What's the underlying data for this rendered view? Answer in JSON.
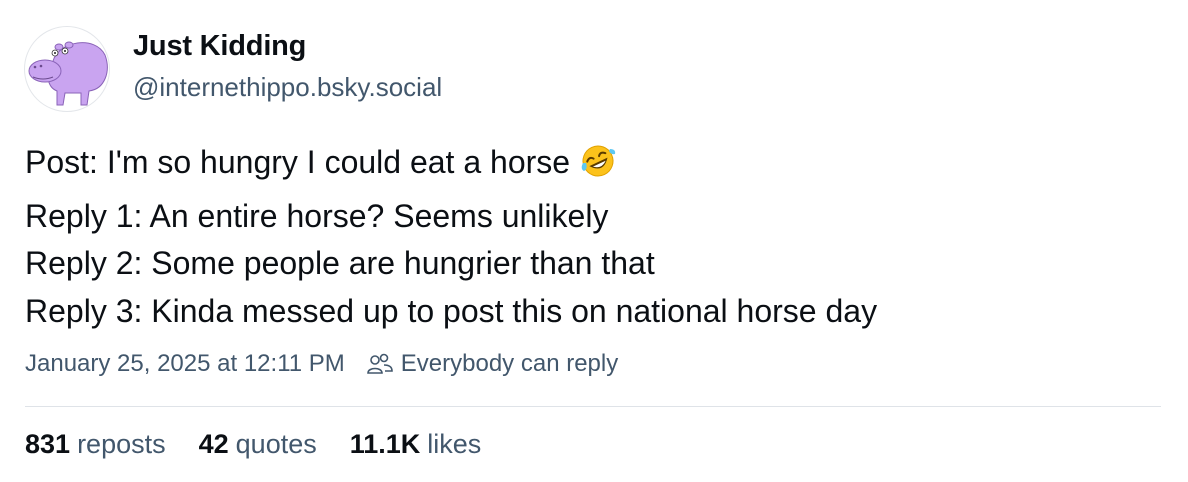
{
  "author": {
    "display_name": "Just Kidding",
    "handle": "@internethippo.bsky.social",
    "avatar_icon": "hippo-avatar-icon"
  },
  "post": {
    "lines": [
      "Post: I'm so hungry I could eat a horse",
      "Reply 1: An entire horse? Seems unlikely",
      "Reply 2: Some people are hungrier than that",
      "Reply 3: Kinda messed up to post this on national horse day"
    ],
    "emoji_icon": "rolling-on-floor-laughing-emoji"
  },
  "meta": {
    "timestamp": "January 25, 2025 at 12:11 PM",
    "reply_setting_icon": "people-icon",
    "reply_setting": "Everybody can reply"
  },
  "stats": {
    "reposts_count": "831",
    "reposts_label": "reposts",
    "quotes_count": "42",
    "quotes_label": "quotes",
    "likes_count": "11.1K",
    "likes_label": "likes"
  },
  "colors": {
    "text": "#0b0f14",
    "muted": "#42576c",
    "divider": "#dfe3e8",
    "avatar_purple": "#c9a4f0"
  }
}
